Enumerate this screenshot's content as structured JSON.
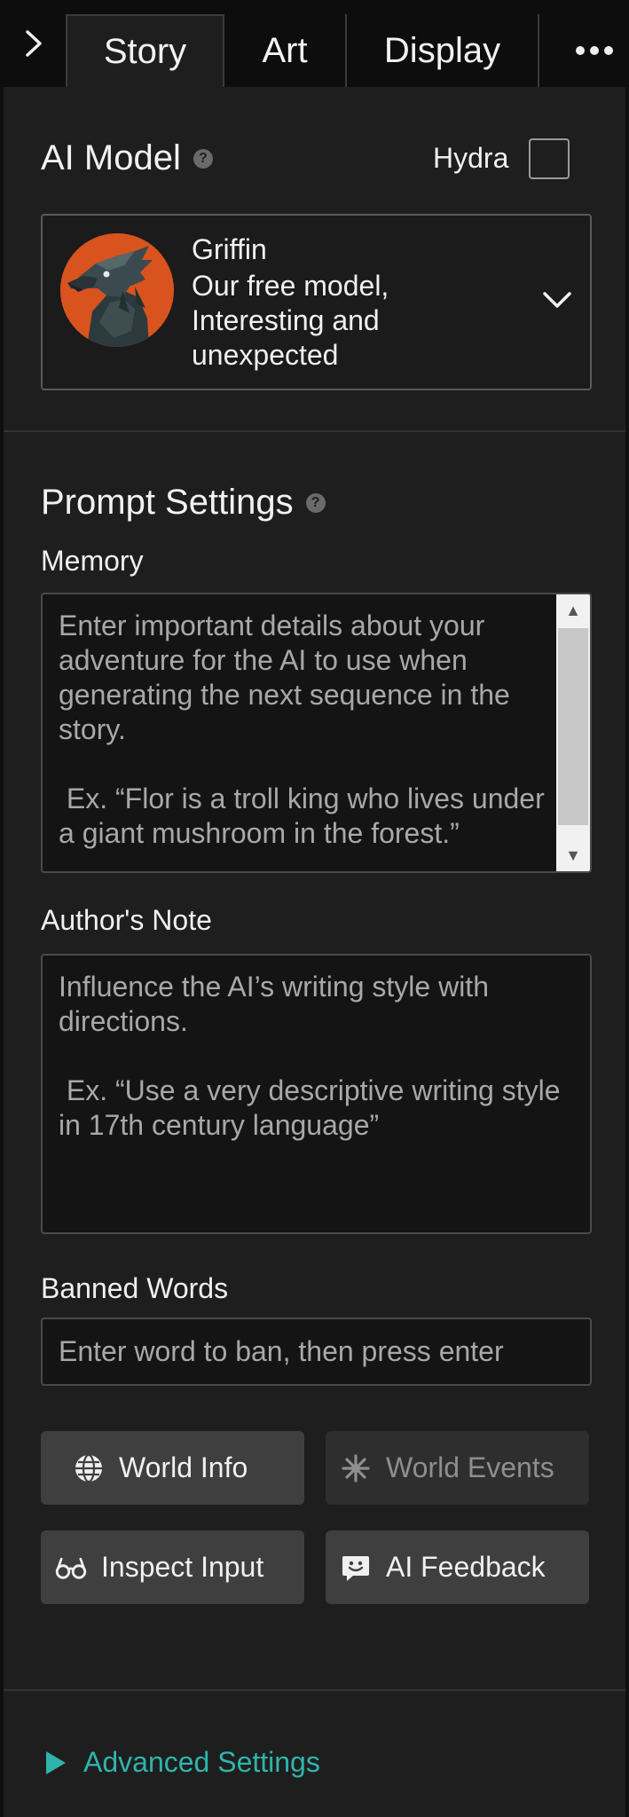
{
  "tabs": {
    "toggle_glyph": "›",
    "items": [
      {
        "label": "Story",
        "active": true
      },
      {
        "label": "Art",
        "active": false
      },
      {
        "label": "Display",
        "active": false
      }
    ]
  },
  "ai_model": {
    "title": "AI Model",
    "help_glyph": "?",
    "hydra_label": "Hydra",
    "hydra_checked": false,
    "selected": {
      "name": "Griffin",
      "description": "Our free model, Interesting and unexpected"
    }
  },
  "prompt_settings": {
    "title": "Prompt Settings",
    "help_glyph": "?",
    "memory": {
      "label": "Memory",
      "placeholder": "Enter important details about your adventure for the AI to use when generating the next sequence in the story.\n\n Ex. “Flor is a troll king who lives under a giant mushroom in the forest.”"
    },
    "authors_note": {
      "label": "Author's Note",
      "placeholder": "Influence the AI’s writing style with directions.\n\n Ex. “Use a very descriptive writing style in 17th century language”"
    },
    "banned_words": {
      "label": "Banned Words",
      "placeholder": "Enter word to ban, then press enter"
    }
  },
  "buttons": {
    "world_info": {
      "label": "World Info",
      "icon": "globe-icon",
      "disabled": false
    },
    "world_events": {
      "label": "World Events",
      "icon": "sparkle-icon",
      "disabled": true
    },
    "inspect_input": {
      "label": "Inspect Input",
      "icon": "glasses-icon",
      "disabled": false
    },
    "ai_feedback": {
      "label": "AI Feedback",
      "icon": "feedback-icon",
      "disabled": false
    }
  },
  "advanced": {
    "label": "Advanced Settings"
  },
  "colors": {
    "accent": "#2fb4ad",
    "avatar_bg": "#d9531e",
    "panel_bg": "#1e1e1e"
  }
}
